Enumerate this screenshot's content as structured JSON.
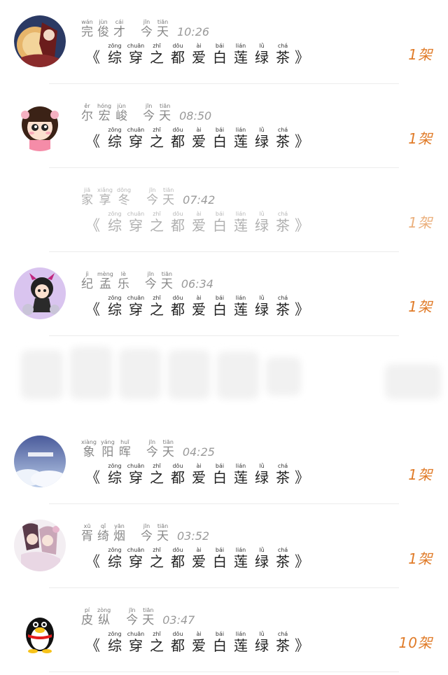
{
  "brand_color": "#e07b28",
  "book": {
    "open_bracket": "《",
    "close_bracket": "》",
    "chars": [
      {
        "hz": "综",
        "py": "zōng"
      },
      {
        "hz": "穿",
        "py": "chuān"
      },
      {
        "hz": "之",
        "py": "zhī"
      },
      {
        "hz": "都",
        "py": "dōu"
      },
      {
        "hz": "爱",
        "py": "ài"
      },
      {
        "hz": "白",
        "py": "bái"
      },
      {
        "hz": "莲",
        "py": "lián"
      },
      {
        "hz": "绿",
        "py": "lǜ"
      },
      {
        "hz": "茶",
        "py": "chá"
      }
    ]
  },
  "today": [
    {
      "hz": "今",
      "py": "jīn"
    },
    {
      "hz": "天",
      "py": "tiān"
    }
  ],
  "entries": [
    {
      "name": [
        {
          "hz": "完",
          "py": "wán"
        },
        {
          "hz": "俊",
          "py": "jùn"
        },
        {
          "hz": "才",
          "py": "cái"
        }
      ],
      "time": "10:26",
      "count": "1架",
      "avatar": "anime-girl-avatar"
    },
    {
      "name": [
        {
          "hz": "尔",
          "py": "ěr"
        },
        {
          "hz": "宏",
          "py": "hóng"
        },
        {
          "hz": "峻",
          "py": "jùn"
        }
      ],
      "time": "08:50",
      "count": "1架",
      "avatar": "cartoon-girl-avatar"
    },
    {
      "name": [
        {
          "hz": "家",
          "py": "jiā"
        },
        {
          "hz": "享",
          "py": "xiǎng"
        },
        {
          "hz": "冬",
          "py": "dōng"
        }
      ],
      "time": "07:42",
      "count": "1架",
      "avatar": "none"
    },
    {
      "name": [
        {
          "hz": "纪",
          "py": "jì"
        },
        {
          "hz": "孟",
          "py": "mèng"
        },
        {
          "hz": "乐",
          "py": "lè"
        }
      ],
      "time": "06:34",
      "count": "1架",
      "avatar": "chibi-devil-avatar"
    },
    {
      "name": [
        {
          "hz": "象",
          "py": "xiàng"
        },
        {
          "hz": "阳",
          "py": "yáng"
        },
        {
          "hz": "晖",
          "py": "huī"
        }
      ],
      "time": "04:25",
      "count": "1架",
      "avatar": "sky-clouds-avatar"
    },
    {
      "name": [
        {
          "hz": "胥",
          "py": "xū"
        },
        {
          "hz": "绮",
          "py": "qǐ"
        },
        {
          "hz": "烟",
          "py": "yān"
        }
      ],
      "time": "03:52",
      "count": "1架",
      "avatar": "anime-couple-avatar"
    },
    {
      "name": [
        {
          "hz": "皮",
          "py": "pí"
        },
        {
          "hz": "纵",
          "py": "zòng"
        }
      ],
      "time": "03:47",
      "count": "10架",
      "avatar": "qq-penguin-avatar"
    }
  ]
}
